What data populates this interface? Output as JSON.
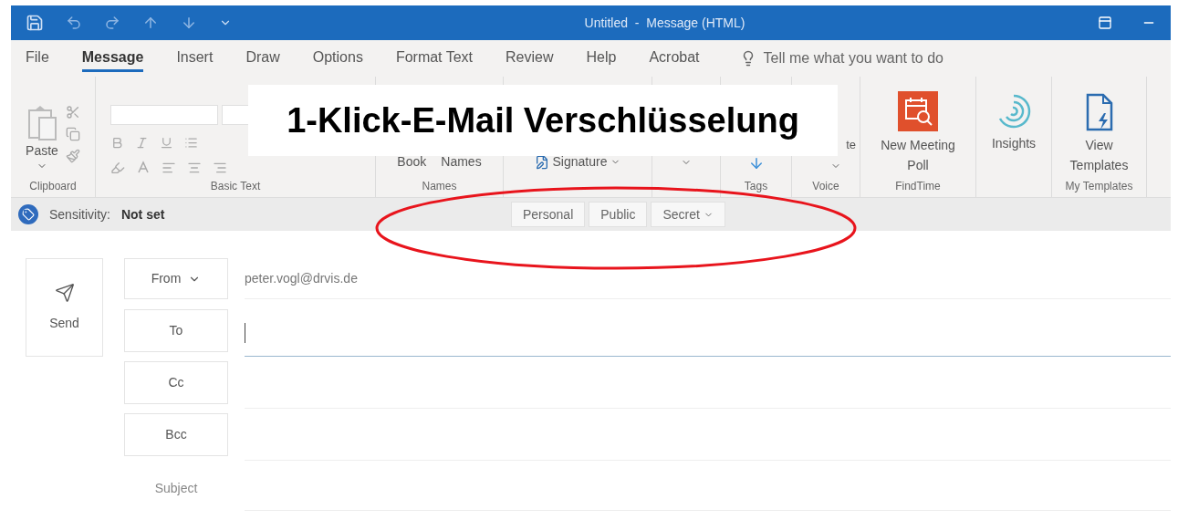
{
  "title_bar": {
    "title": "Untitled  -  Message (HTML)"
  },
  "tabs": [
    {
      "label": "File",
      "selected": false
    },
    {
      "label": "Message",
      "selected": true
    },
    {
      "label": "Insert",
      "selected": false
    },
    {
      "label": "Draw",
      "selected": false
    },
    {
      "label": "Options",
      "selected": false
    },
    {
      "label": "Format Text",
      "selected": false
    },
    {
      "label": "Review",
      "selected": false
    },
    {
      "label": "Help",
      "selected": false
    },
    {
      "label": "Acrobat",
      "selected": false
    }
  ],
  "tell_me": {
    "placeholder": "Tell me what you want to do"
  },
  "ribbon_groups": [
    {
      "kind": "clipboard",
      "label": "Clipboard",
      "buttons": [
        "Paste"
      ]
    },
    {
      "kind": "basic_text",
      "label": "Basic Text"
    },
    {
      "kind": "names",
      "label": "Names",
      "buttons": [
        "Book",
        "Names"
      ]
    },
    {
      "kind": "include",
      "buttons": [
        "Signature"
      ]
    },
    {
      "kind": "protection"
    },
    {
      "kind": "tags",
      "label": "Tags"
    },
    {
      "kind": "voice",
      "label": "Voice",
      "buttons": [
        "te"
      ]
    },
    {
      "kind": "findtime",
      "label": "FindTime",
      "buttons": [
        "New Meeting Poll"
      ]
    },
    {
      "kind": "insights",
      "buttons": [
        "Insights"
      ]
    },
    {
      "kind": "templates",
      "label": "My Templates",
      "buttons": [
        "View Templates"
      ]
    }
  ],
  "banner": {
    "text": "1-Klick-E-Mail Verschlüsselung"
  },
  "sensitivity": {
    "label": "Sensitivity:",
    "value": "Not set",
    "options": [
      {
        "label": "Personal",
        "dropdown": false
      },
      {
        "label": "Public",
        "dropdown": false
      },
      {
        "label": "Secret",
        "dropdown": true
      }
    ]
  },
  "compose": {
    "send": "Send",
    "from": {
      "label": "From",
      "value": "peter.vogl@drvis.de"
    },
    "recipients": [
      {
        "label": "To",
        "focused": true
      },
      {
        "label": "Cc",
        "focused": false
      },
      {
        "label": "Bcc",
        "focused": false
      }
    ],
    "subject_label": "Subject"
  }
}
